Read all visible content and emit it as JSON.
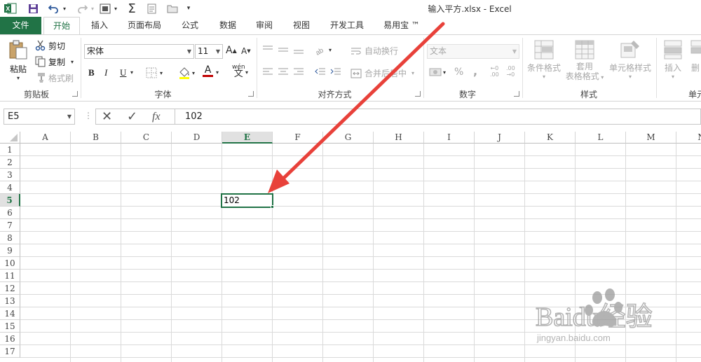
{
  "window": {
    "title": "输入平方.xlsx - Excel"
  },
  "quick_access": {
    "more": "▾"
  },
  "tabs": [
    {
      "id": "file",
      "label": "文件"
    },
    {
      "id": "home",
      "label": "开始"
    },
    {
      "id": "insert",
      "label": "插入"
    },
    {
      "id": "layout",
      "label": "页面布局"
    },
    {
      "id": "formulas",
      "label": "公式"
    },
    {
      "id": "data",
      "label": "数据"
    },
    {
      "id": "review",
      "label": "审阅"
    },
    {
      "id": "view",
      "label": "视图"
    },
    {
      "id": "developer",
      "label": "开发工具"
    },
    {
      "id": "easy",
      "label": "易用宝 ™"
    }
  ],
  "ribbon": {
    "clipboard": {
      "label": "剪贴板",
      "paste": "粘贴",
      "cut": "剪切",
      "copy": "复制",
      "format_painter": "格式刷"
    },
    "font": {
      "label": "字体",
      "font_name": "宋体",
      "font_size": "11",
      "bold": "B",
      "italic": "I",
      "underline": "U",
      "grow": "A",
      "shrink": "A",
      "color": "A",
      "phonetic": "wén"
    },
    "alignment": {
      "label": "对齐方式",
      "wrap": "自动换行",
      "merge": "合并后居中"
    },
    "number": {
      "label": "数字",
      "format": "文本",
      "percent": "%",
      "comma": ",",
      "inc_decimal": ".00",
      "dec_decimal": ".00"
    },
    "styles": {
      "label": "样式",
      "conditional": "条件格式",
      "table_line1": "套用",
      "table_line2": "表格格式",
      "cell_styles": "单元格样式"
    },
    "cells": {
      "label": "单元",
      "insert": "插入",
      "delete": "删"
    }
  },
  "formula_bar": {
    "name_box": "E5",
    "cancel": "✕",
    "enter": "✓",
    "fx": "fx",
    "value": "102"
  },
  "sheet": {
    "columns": [
      "A",
      "B",
      "C",
      "D",
      "E",
      "F",
      "G",
      "H",
      "I",
      "J",
      "K",
      "L",
      "M",
      "N"
    ],
    "rows": [
      "1",
      "2",
      "3",
      "4",
      "5",
      "6",
      "7",
      "8",
      "9",
      "10",
      "11",
      "12",
      "13",
      "14",
      "15",
      "16",
      "17"
    ],
    "active_column": "E",
    "active_row": "5",
    "active_cell_value": "102"
  },
  "annotation": {
    "arrow_color": "#e8413a"
  },
  "colors": {
    "accent": "#217346"
  },
  "watermark": {
    "brand": "Baidu经验",
    "url": "jingyan.baidu.com"
  }
}
